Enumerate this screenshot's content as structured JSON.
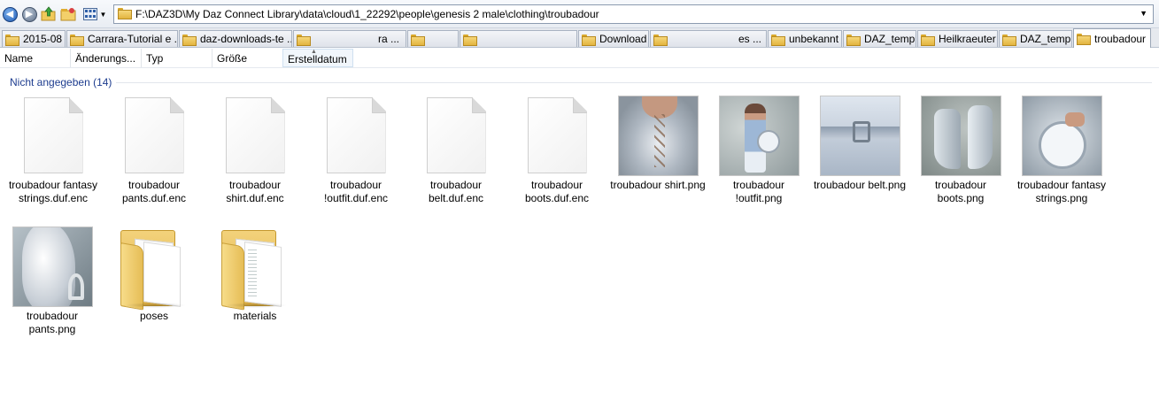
{
  "toolbar": {
    "address": "F:\\DAZ3D\\My Daz Connect Library\\data\\cloud\\1_22292\\people\\genesis 2 male\\clothing\\troubadour",
    "back_icon": "back-arrow-icon",
    "forward_icon": "forward-arrow-icon",
    "up_icon": "up-folder-icon",
    "favorites_icon": "folder-favorites-icon",
    "view_icon": "view-mode-icon"
  },
  "tabs": [
    {
      "label": "2015-08"
    },
    {
      "label": "Carrara-Tutorial e ..."
    },
    {
      "label": "daz-downloads-te ..."
    },
    {
      "label": "ra ..."
    },
    {
      "label": ""
    },
    {
      "label": ""
    },
    {
      "label": "Download"
    },
    {
      "label": "es ..."
    },
    {
      "label": "unbekannt"
    },
    {
      "label": "DAZ_temp"
    },
    {
      "label": "Heilkraeuter"
    },
    {
      "label": "DAZ_temp"
    },
    {
      "label": "troubadour"
    }
  ],
  "columns": [
    {
      "label": "Name"
    },
    {
      "label": "Änderungs..."
    },
    {
      "label": "Typ"
    },
    {
      "label": "Größe"
    },
    {
      "label": "Erstelldatum"
    }
  ],
  "group": {
    "label": "Nicht angegeben (14)"
  },
  "items": [
    {
      "label": "troubadour fantasy strings.duf.enc",
      "kind": "file"
    },
    {
      "label": "troubadour pants.duf.enc",
      "kind": "file"
    },
    {
      "label": "troubadour shirt.duf.enc",
      "kind": "file"
    },
    {
      "label": "troubadour !outfit.duf.enc",
      "kind": "file"
    },
    {
      "label": "troubadour belt.duf.enc",
      "kind": "file"
    },
    {
      "label": "troubadour boots.duf.enc",
      "kind": "file"
    },
    {
      "label": "troubadour shirt.png",
      "kind": "image"
    },
    {
      "label": "troubadour !outfit.png",
      "kind": "image"
    },
    {
      "label": "troubadour belt.png",
      "kind": "image"
    },
    {
      "label": "troubadour boots.png",
      "kind": "image"
    },
    {
      "label": "troubadour fantasy strings.png",
      "kind": "image"
    },
    {
      "label": "troubadour pants.png",
      "kind": "image"
    },
    {
      "label": "poses",
      "kind": "folder"
    },
    {
      "label": "materials",
      "kind": "folder"
    }
  ],
  "colors": {
    "group_header": "#1e3d8f",
    "folder": "#e2b43f",
    "toolbar_bg": "#eef1f5"
  }
}
